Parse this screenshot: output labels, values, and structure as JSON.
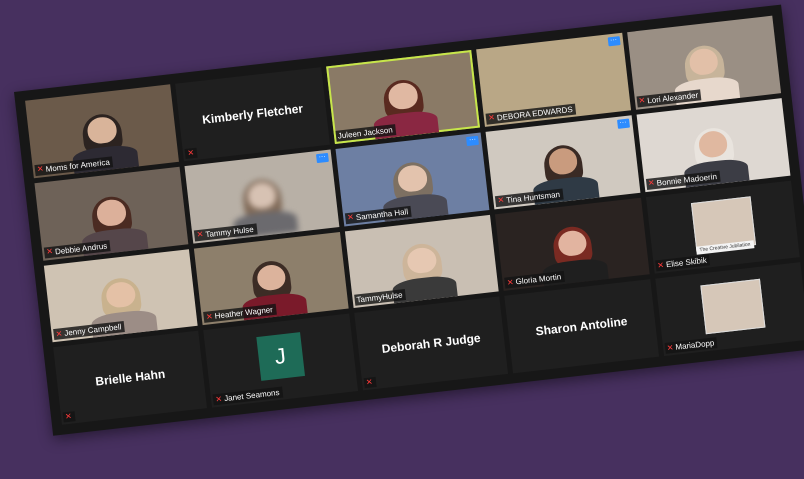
{
  "window": {
    "background_color": "#47305f",
    "gallery_background": "#171717"
  },
  "participants": [
    {
      "name": "Moms for America",
      "type": "video",
      "muted": true
    },
    {
      "name": "Kimberly Fletcher",
      "type": "name_only",
      "muted": true
    },
    {
      "name": "Juleen Jackson",
      "type": "video",
      "muted": false,
      "active_speaker": true
    },
    {
      "name": "DEBORA EDWARDS",
      "type": "video",
      "muted": true,
      "more_button": true
    },
    {
      "name": "Lori Alexander",
      "type": "video",
      "muted": true
    },
    {
      "name": "Debbie Andrus",
      "type": "video",
      "muted": true
    },
    {
      "name": "Tammy Hulse",
      "type": "video",
      "muted": true,
      "more_button": true
    },
    {
      "name": "Samantha Hall",
      "type": "video",
      "muted": true,
      "more_button": true
    },
    {
      "name": "Tina Huntsman",
      "type": "video",
      "muted": true,
      "more_button": true
    },
    {
      "name": "Bonnie Madoerin",
      "type": "video",
      "muted": true
    },
    {
      "name": "Jenny Campbell",
      "type": "video",
      "muted": true
    },
    {
      "name": "Heather Wagner",
      "type": "video",
      "muted": true
    },
    {
      "name": "TammyHulse",
      "type": "video",
      "muted": false
    },
    {
      "name": "Gloria Mortin",
      "type": "video",
      "muted": true
    },
    {
      "name": "Elise Skibik",
      "type": "image",
      "muted": true,
      "caption": "The Creative Jubilation"
    },
    {
      "name": "Brielle Hahn",
      "type": "name_only",
      "muted": true
    },
    {
      "name": "Janet Seamons",
      "type": "avatar",
      "initial": "J",
      "muted": true
    },
    {
      "name": "Deborah R Judge",
      "type": "name_only",
      "muted": true
    },
    {
      "name": "Sharon Antoline",
      "type": "name_only",
      "muted": false
    },
    {
      "name": "MariaDopp",
      "type": "image",
      "muted": true
    }
  ],
  "icons": {
    "mic_off": "mic-muted-icon",
    "more": "more-options-icon"
  },
  "glyphs": {
    "mic_off": "🎙",
    "more": "···"
  }
}
